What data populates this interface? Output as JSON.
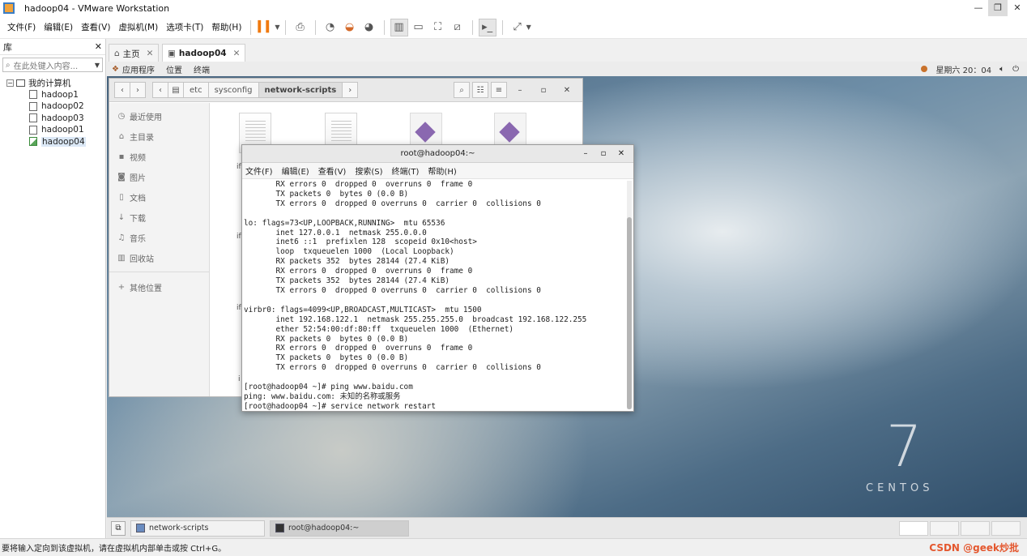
{
  "window": {
    "title": "hadoop04 - VMware Workstation",
    "minimize": "—",
    "restore": "❐",
    "close": "✕"
  },
  "menu": [
    "文件(F)",
    "编辑(E)",
    "查看(V)",
    "虚拟机(M)",
    "选项卡(T)",
    "帮助(H)"
  ],
  "toolbar_icons": [
    "pause-icon",
    "send-keys-icon",
    "snapshot-icon",
    "revert-snapshot-icon",
    "snapshot-manager-icon",
    "show-library-icon",
    "thumbnail-bar-icon",
    "full-screen-icon",
    "unity-icon",
    "console-view-icon",
    "stretch-guest-icon"
  ],
  "library": {
    "title": "库",
    "close": "✕",
    "search_placeholder": "在此处键入内容...",
    "root": "我的计算机",
    "vms": [
      "hadoop1",
      "hadoop02",
      "hadoop03",
      "hadoop01",
      "hadoop04"
    ],
    "selected": "hadoop04"
  },
  "tabs": [
    {
      "label": "主页",
      "close": "✕"
    },
    {
      "label": "hadoop04",
      "close": "✕"
    }
  ],
  "gnome_top": {
    "applications": "应用程序",
    "places": "位置",
    "terminal": "终端",
    "clock": "星期六 20：04"
  },
  "files": {
    "path": [
      "etc",
      "sysconfig",
      "network-scripts"
    ],
    "sidebar": [
      {
        "icon": "clock-icon",
        "label": "最近使用"
      },
      {
        "icon": "home-icon",
        "label": "主目录"
      },
      {
        "icon": "video-icon",
        "label": "视频"
      },
      {
        "icon": "camera-icon",
        "label": "图片"
      },
      {
        "icon": "document-icon",
        "label": "文档"
      },
      {
        "icon": "download-icon",
        "label": "下载"
      },
      {
        "icon": "music-icon",
        "label": "音乐"
      },
      {
        "icon": "trash-icon",
        "label": "回收站"
      },
      {
        "icon": "plus-icon",
        "label": "其他位置"
      }
    ],
    "partial_names": [
      "if",
      "if",
      "if",
      "i"
    ]
  },
  "terminal": {
    "title": "root@hadoop04:~",
    "menu": [
      "文件(F)",
      "编辑(E)",
      "查看(V)",
      "搜索(S)",
      "终端(T)",
      "帮助(H)"
    ],
    "lines": [
      "       RX errors 0  dropped 0  overruns 0  frame 0",
      "       TX packets 0  bytes 0 (0.0 B)",
      "       TX errors 0  dropped 0 overruns 0  carrier 0  collisions 0",
      "",
      "lo: flags=73<UP,LOOPBACK,RUNNING>  mtu 65536",
      "       inet 127.0.0.1  netmask 255.0.0.0",
      "       inet6 ::1  prefixlen 128  scopeid 0x10<host>",
      "       loop  txqueuelen 1000  (Local Loopback)",
      "       RX packets 352  bytes 28144 (27.4 KiB)",
      "       RX errors 0  dropped 0  overruns 0  frame 0",
      "       TX packets 352  bytes 28144 (27.4 KiB)",
      "       TX errors 0  dropped 0 overruns 0  carrier 0  collisions 0",
      "",
      "virbr0: flags=4099<UP,BROADCAST,MULTICAST>  mtu 1500",
      "       inet 192.168.122.1  netmask 255.255.255.0  broadcast 192.168.122.255",
      "       ether 52:54:00:df:80:ff  txqueuelen 1000  (Ethernet)",
      "       RX packets 0  bytes 0 (0.0 B)",
      "       RX errors 0  dropped 0  overruns 0  frame 0",
      "       TX packets 0  bytes 0 (0.0 B)",
      "       TX errors 0  dropped 0 overruns 0  carrier 0  collisions 0",
      "",
      "[root@hadoop04 ~]# ping www.baidu.com",
      "ping: www.baidu.com: 未知的名称或服务",
      "[root@hadoop04 ~]# service network restart"
    ]
  },
  "centos": {
    "seven": "7",
    "word": "CENTOS"
  },
  "taskbar": [
    {
      "label": "network-scripts"
    },
    {
      "label": "root@hadoop04:~"
    }
  ],
  "status": {
    "hint": "要将输入定向到该虚拟机，请在虚拟机内部单击或按 Ctrl+G。",
    "watermark": "CSDN @geek炒批"
  }
}
